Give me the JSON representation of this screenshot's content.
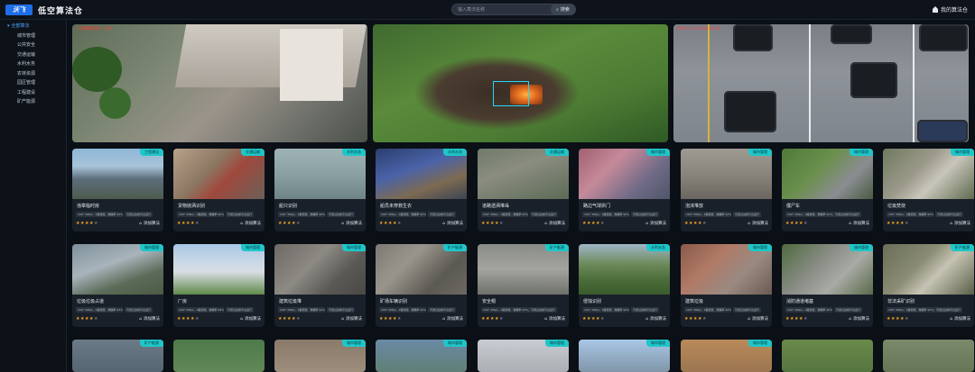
{
  "app": {
    "logo_text": "沃飞",
    "title": "低空算法仓"
  },
  "search": {
    "placeholder": "输入算法名称",
    "button_label": "搜索"
  },
  "user": {
    "label": "我的算法仓"
  },
  "sidebar": {
    "items": [
      {
        "label": "全部算法",
        "active": true
      },
      {
        "label": "城市管理"
      },
      {
        "label": "公共安全"
      },
      {
        "label": "交通运输"
      },
      {
        "label": "水利水务"
      },
      {
        "label": "农林资源"
      },
      {
        "label": "园区管理"
      },
      {
        "label": "工程建设"
      },
      {
        "label": "矿产能源"
      }
    ]
  },
  "hero": {
    "left_overlay": "人员聚集识别 · 145",
    "right_overlay": "2024-12-14 09:14:30"
  },
  "colors": {
    "accent": "#1fc6c9",
    "star": "#f5a623",
    "detect": "#23d8ff",
    "alert": "#ff3b3b"
  },
  "cards": [
    {
      "tag": "工程建设",
      "title": "违章临时房",
      "chip1": "100° 30fps、1路视频、准确率 92%",
      "chip2": "可通过边缘平台运行",
      "stars": 4,
      "img": "linear-gradient(180deg,#8fb6d8 0%,#a9c4d9 35%,#5c6e7c 60%,#4d5a4c 100%)"
    },
    {
      "tag": "交通运输",
      "title": "货物抛洒识别",
      "chip1": "100° 30fps、1路视频、准确率 90%",
      "chip2": "可通过边缘平台运行",
      "stars": 4,
      "img": "linear-gradient(135deg,#b7a28b 0%,#8c7763 40%,#a0483c 60%,#6a6158 100%)"
    },
    {
      "tag": "水利水务",
      "title": "船只识别",
      "chip1": "100° 30fps、1路视频、准确率 96%",
      "chip2": "可通过边缘平台运行",
      "stars": 4,
      "img": "linear-gradient(180deg,#9fb3b6 0%,#8aa0a2 50%,#6f8486 100%)"
    },
    {
      "tag": "水利水务",
      "title": "船员未穿救生衣",
      "chip1": "100° 30fps、1路视频、准确率 92%",
      "chip2": "可通过边缘平台运行",
      "stars": 4,
      "img": "linear-gradient(160deg,#2a3e6e 0%,#4a63a8 40%,#7d6a52 70%,#3b4452 100%)"
    },
    {
      "tag": "交通运输",
      "title": "道路遗洒堆垛",
      "chip1": "100° 30fps、1路视频、准确率 93%",
      "chip2": "可通过边缘平台运行",
      "stars": 4,
      "img": "linear-gradient(160deg,#6f7a6a 0%,#8a8d80 40%,#5d6a55 100%)"
    },
    {
      "tag": "城市管理",
      "title": "路边气球拱门",
      "chip1": "100° 30fps、1路视频、准确率 94%",
      "chip2": "可通过边缘平台运行",
      "stars": 4,
      "img": "linear-gradient(135deg,#a06070 0%,#c58a9a 35%,#6f6a86 70%,#4f5668 100%)"
    },
    {
      "tag": "城市管理",
      "title": "泡沫堆放",
      "chip1": "100° 30fps、1路视频、准确率 92%",
      "chip2": "可通过边缘平台运行",
      "stars": 4,
      "img": "linear-gradient(180deg,#9e9a92 0%,#8a857c 50%,#6a665f 100%)"
    },
    {
      "tag": "城市管理",
      "title": "僵尸车",
      "chip1": "100° 30fps、1路视频、准确率 93%，可通过边缘平台运行",
      "chip2": "",
      "stars": 4,
      "img": "linear-gradient(135deg,#4f7a3a 0%,#6b8f4c 40%,#8a8d92 70%,#4b5a44 100%)"
    },
    {
      "tag": "城市管理",
      "title": "垃圾焚烧",
      "chip1": "100° 30fps、1路视频、准确率 92%",
      "chip2": "可通过边缘平台运行",
      "stars": 4,
      "img": "linear-gradient(135deg,#6e7a5f 0%,#9c9a8a 40%,#c9c6bc 60%,#5d6a4c 100%)"
    },
    {
      "tag": "城市管理",
      "title": "垃圾垃圾占道",
      "chip1": "100° 30fps、1路视频、准确率 93%",
      "chip2": "可通过边缘平台运行",
      "stars": 4,
      "img": "linear-gradient(160deg,#7e8f9a 0%,#a8b4bb 40%,#5b6b58 70%,#4a5a44 100%)"
    },
    {
      "tag": "城市管理",
      "title": "厂房",
      "chip1": "100° 30fps、1路视频、准确率 94%",
      "chip2": "可通过边缘平台运行",
      "stars": 4,
      "img": "linear-gradient(180deg,#a9c7e6 0%,#c9d8e6 35%,#d9dde2 55%,#5f8a4a 100%)"
    },
    {
      "tag": "城市管理",
      "title": "建筑垃圾堆",
      "chip1": "100° 30fps、1路视频、准确率 92%",
      "chip2": "可通过边缘平台运行",
      "stars": 4,
      "img": "linear-gradient(135deg,#6d6a66 0%,#8d8a84 40%,#5a5955 70%,#4a4845 100%)"
    },
    {
      "tag": "矿产能源",
      "title": "矿场车辆识别",
      "chip1": "100° 30fps、1路视频、准确率 92%",
      "chip2": "可通过边缘平台运行",
      "stars": 4,
      "img": "linear-gradient(135deg,#7d7a73 0%,#9a958c 35%,#5b5953 70%,#6c6961 100%)"
    },
    {
      "tag": "矿产能源",
      "title": "安全帽",
      "chip1": "100° 30fps、1路视频、准确率 93%，可通过边缘平台运行",
      "chip2": "",
      "stars": 4,
      "img": "linear-gradient(180deg,#8a8c88 0%,#a3a49e 50%,#6e706a 100%)"
    },
    {
      "tag": "水利水务",
      "title": "侵蚀识别",
      "chip1": "100° 30fps、1路视频、准确率 94%",
      "chip2": "可通过边缘平台运行",
      "stars": 4,
      "img": "linear-gradient(180deg,#9fb6c7 0%,#6c8a5a 40%,#4c6e3a 70%,#3a5a2c 100%)"
    },
    {
      "tag": "城市管理",
      "title": "建筑垃圾",
      "chip1": "100° 30fps、1路视频、准确率 92%",
      "chip2": "可通过边缘平台运行",
      "stars": 4,
      "img": "linear-gradient(135deg,#8a5a4a 0%,#b07a66 35%,#9a8a82 65%,#6a5a52 100%)"
    },
    {
      "tag": "城市管理",
      "title": "消防通道堵塞",
      "chip1": "100° 30fps、1路视频、准确率 92%",
      "chip2": "可通过边缘平台运行",
      "stars": 4,
      "img": "linear-gradient(135deg,#4f6a3e 0%,#8a8d86 40%,#a8aaa4 65%,#5a6a4a 100%)"
    },
    {
      "tag": "矿产能源",
      "title": "非法采矿识别",
      "chip1": "100° 30fps、1路视频、准确率 92%，可通过边缘平台运行",
      "chip2": "",
      "stars": 4,
      "img": "linear-gradient(135deg,#6a6e58 0%,#8a8c74 40%,#c6c4b4 60%,#5a5e48 100%)"
    },
    {
      "tag": "矿产能源",
      "title": "",
      "chip1": "",
      "chip2": "",
      "stars": 0,
      "img": "linear-gradient(180deg,#6b7a86 0%,#4a5a66 100%)"
    },
    {
      "tag": "",
      "title": "",
      "chip1": "",
      "chip2": "",
      "stars": 0,
      "img": "linear-gradient(180deg,#4e7a4a 0%,#6b8f5c 100%)"
    },
    {
      "tag": "城市管理",
      "title": "",
      "chip1": "",
      "chip2": "",
      "stars": 0,
      "img": "linear-gradient(180deg,#8a7a6a 0%,#a89888 100%)"
    },
    {
      "tag": "城市管理",
      "title": "",
      "chip1": "",
      "chip2": "",
      "stars": 0,
      "img": "linear-gradient(180deg,#6a8aa6 0%,#5a7a5a 100%)"
    },
    {
      "tag": "城市管理",
      "title": "",
      "chip1": "",
      "chip2": "",
      "stars": 0,
      "img": "linear-gradient(180deg,#c9ccd0 0%,#9a9ea4 100%)"
    },
    {
      "tag": "城市管理",
      "title": "",
      "chip1": "",
      "chip2": "",
      "stars": 0,
      "img": "linear-gradient(180deg,#a9c7e6 0%,#6a7a86 100%)"
    },
    {
      "tag": "城市管理",
      "title": "",
      "chip1": "",
      "chip2": "",
      "stars": 0,
      "img": "linear-gradient(180deg,#b98a5a 0%,#8a6a4a 100%)"
    },
    {
      "tag": "",
      "title": "",
      "chip1": "",
      "chip2": "",
      "stars": 0,
      "img": "linear-gradient(180deg,#6a8a4a 0%,#4a6a3a 100%)"
    },
    {
      "tag": "",
      "title": "",
      "chip1": "",
      "chip2": "",
      "stars": 0,
      "img": "linear-gradient(180deg,#7a8a6a 0%,#5a6a4a 100%)"
    }
  ],
  "card_action_label": "添加算法"
}
